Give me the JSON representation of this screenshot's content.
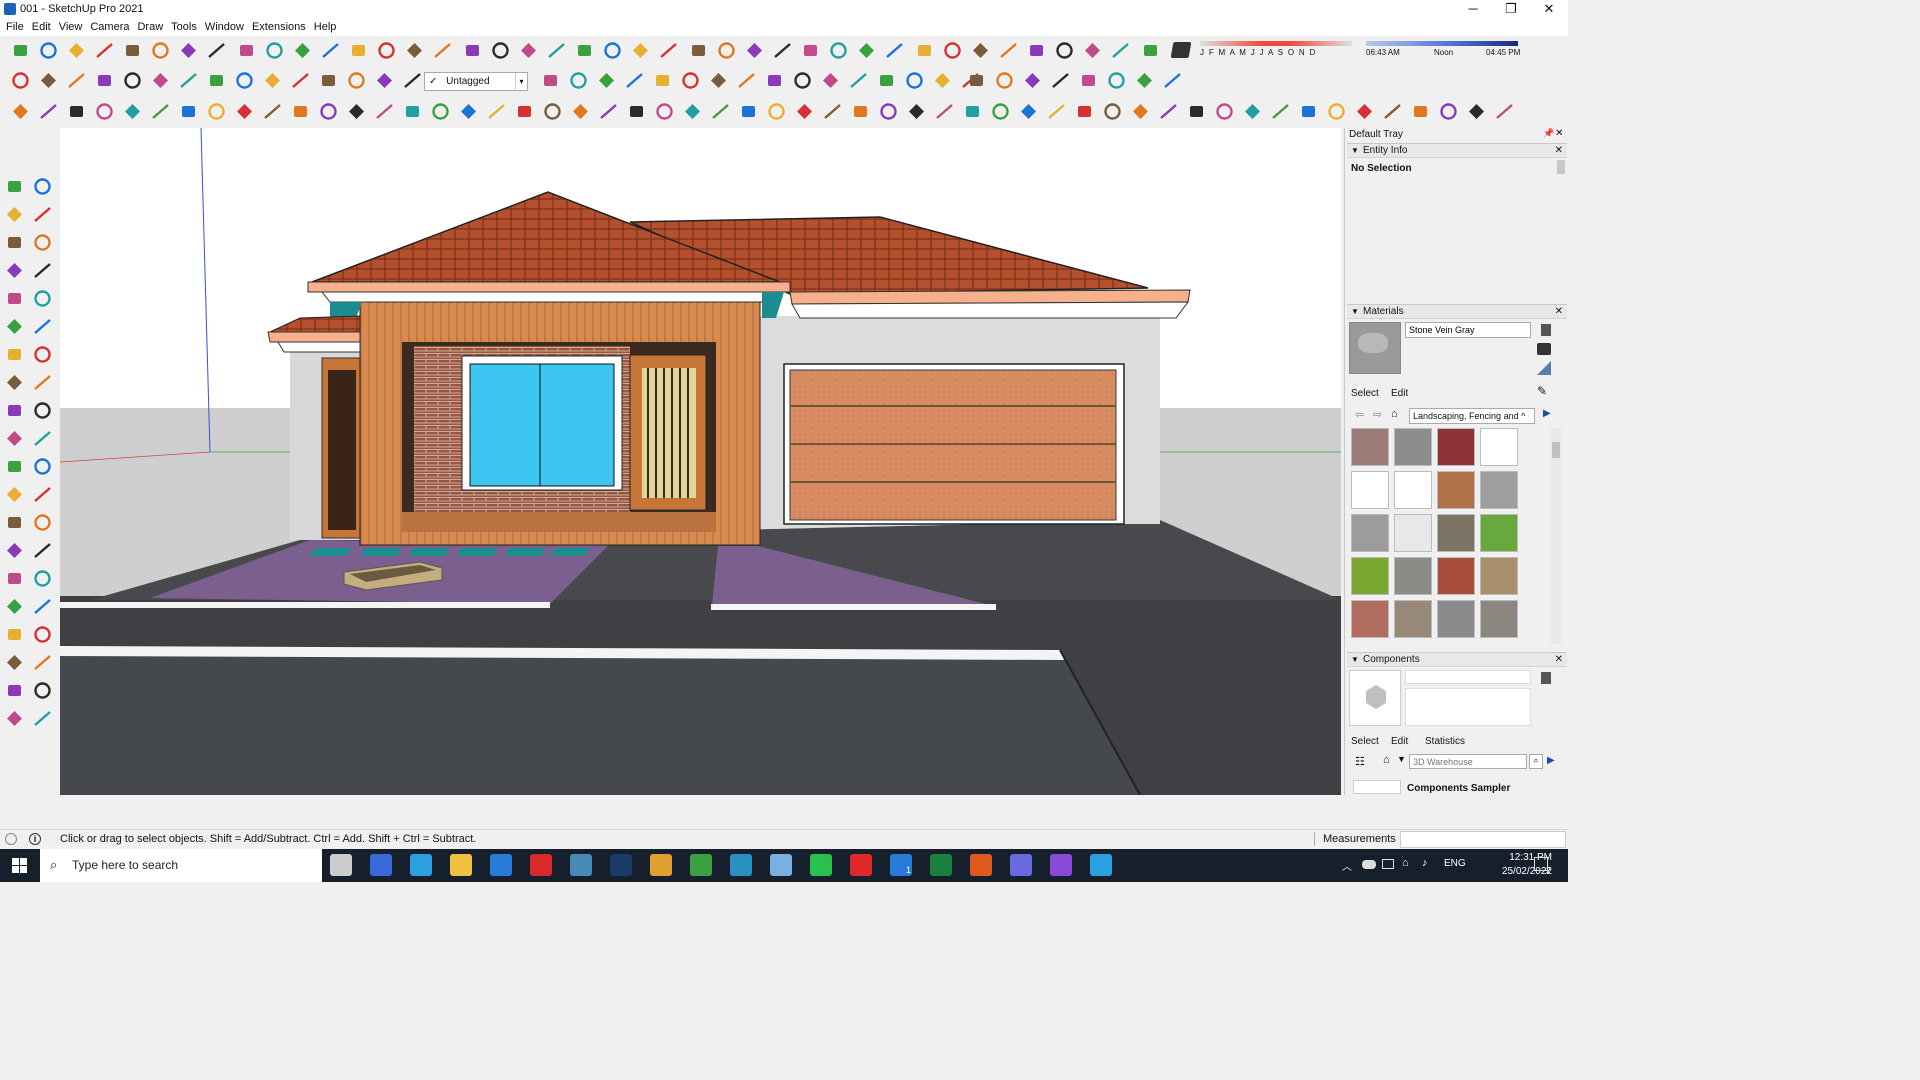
{
  "window": {
    "title": "001 - SketchUp Pro 2021",
    "minimize": "─",
    "maximize": "❐",
    "close": "✕"
  },
  "menu": [
    "File",
    "Edit",
    "View",
    "Camera",
    "Draw",
    "Tools",
    "Window",
    "Extensions",
    "Help"
  ],
  "toolbar": {
    "tag_check": "✓",
    "tag_value": "Untagged",
    "months": "J F M A M J J A S O N D",
    "time_start": "06:43 AM",
    "time_mid": "Noon",
    "time_end": "04:45 PM"
  },
  "tray": {
    "title": "Default Tray",
    "entity_info": {
      "header": "Entity Info",
      "value": "No Selection"
    },
    "materials": {
      "header": "Materials",
      "name": "Stone Vein Gray",
      "tab_select": "Select",
      "tab_edit": "Edit",
      "collection": "Landscaping, Fencing and ^",
      "swatch_colors": [
        "#9c7b76",
        "#8d8d8d",
        "#8e3437",
        "#ffffff",
        "#ffffff",
        "#ffffff",
        "#b07048",
        "#9e9e9e",
        "#9c9c9c",
        "#e8e8e8",
        "#7e7466",
        "#68a83c",
        "#7aa830",
        "#8a8a86",
        "#a84c3c",
        "#a8906c",
        "#b06c5e",
        "#988878",
        "#8a8a8a",
        "#8c8680"
      ]
    },
    "components": {
      "header": "Components",
      "tab_select": "Select",
      "tab_edit": "Edit",
      "tab_statistics": "Statistics",
      "search_placeholder": "3D Warehouse",
      "sampler": "Components Sampler"
    }
  },
  "status": {
    "hint": "Click or drag to select objects. Shift = Add/Subtract. Ctrl = Add. Shift + Ctrl = Subtract.",
    "measurements_label": "Measurements"
  },
  "taskbar": {
    "search_placeholder": "Type here to search",
    "lang": "ENG",
    "time": "12:31 PM",
    "date": "25/02/2022",
    "notify_count": "2",
    "badge_outlook": "1"
  }
}
